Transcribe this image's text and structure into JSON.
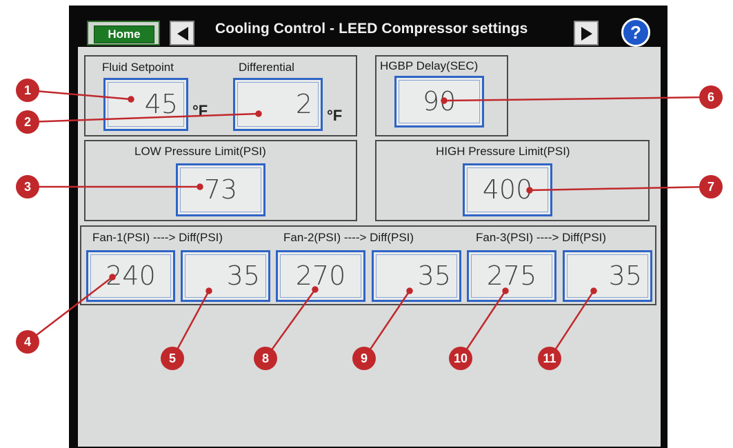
{
  "header": {
    "home_label": "Home",
    "title": "Cooling Control - LEED Compressor settings",
    "prev_icon": "triangle-left-icon",
    "next_icon": "triangle-right-icon",
    "help_label": "?"
  },
  "fluid": {
    "setpoint_label": "Fluid Setpoint",
    "setpoint_value": "45",
    "setpoint_unit": "°F",
    "differential_label": "Differential",
    "differential_value": "2",
    "differential_unit": "°F"
  },
  "hgbp": {
    "label": "HGBP Delay(SEC)",
    "value": "90"
  },
  "low_pressure": {
    "label": "LOW Pressure Limit(PSI)",
    "value": "73"
  },
  "high_pressure": {
    "label": "HIGH Pressure Limit(PSI)",
    "value": "400"
  },
  "fans": {
    "labels": [
      "Fan-1(PSI) ----> Diff(PSI)",
      "Fan-2(PSI) ----> Diff(PSI)",
      "Fan-3(PSI) ----> Diff(PSI)"
    ],
    "values": [
      "240",
      "35",
      "270",
      "35",
      "275",
      "35"
    ]
  },
  "markers": [
    "1",
    "2",
    "3",
    "4",
    "5",
    "6",
    "7",
    "8",
    "9",
    "10",
    "11"
  ],
  "colors": {
    "marker": "#c1282c",
    "accent_blue": "#2f64c7",
    "home_green": "#1c7a25"
  }
}
